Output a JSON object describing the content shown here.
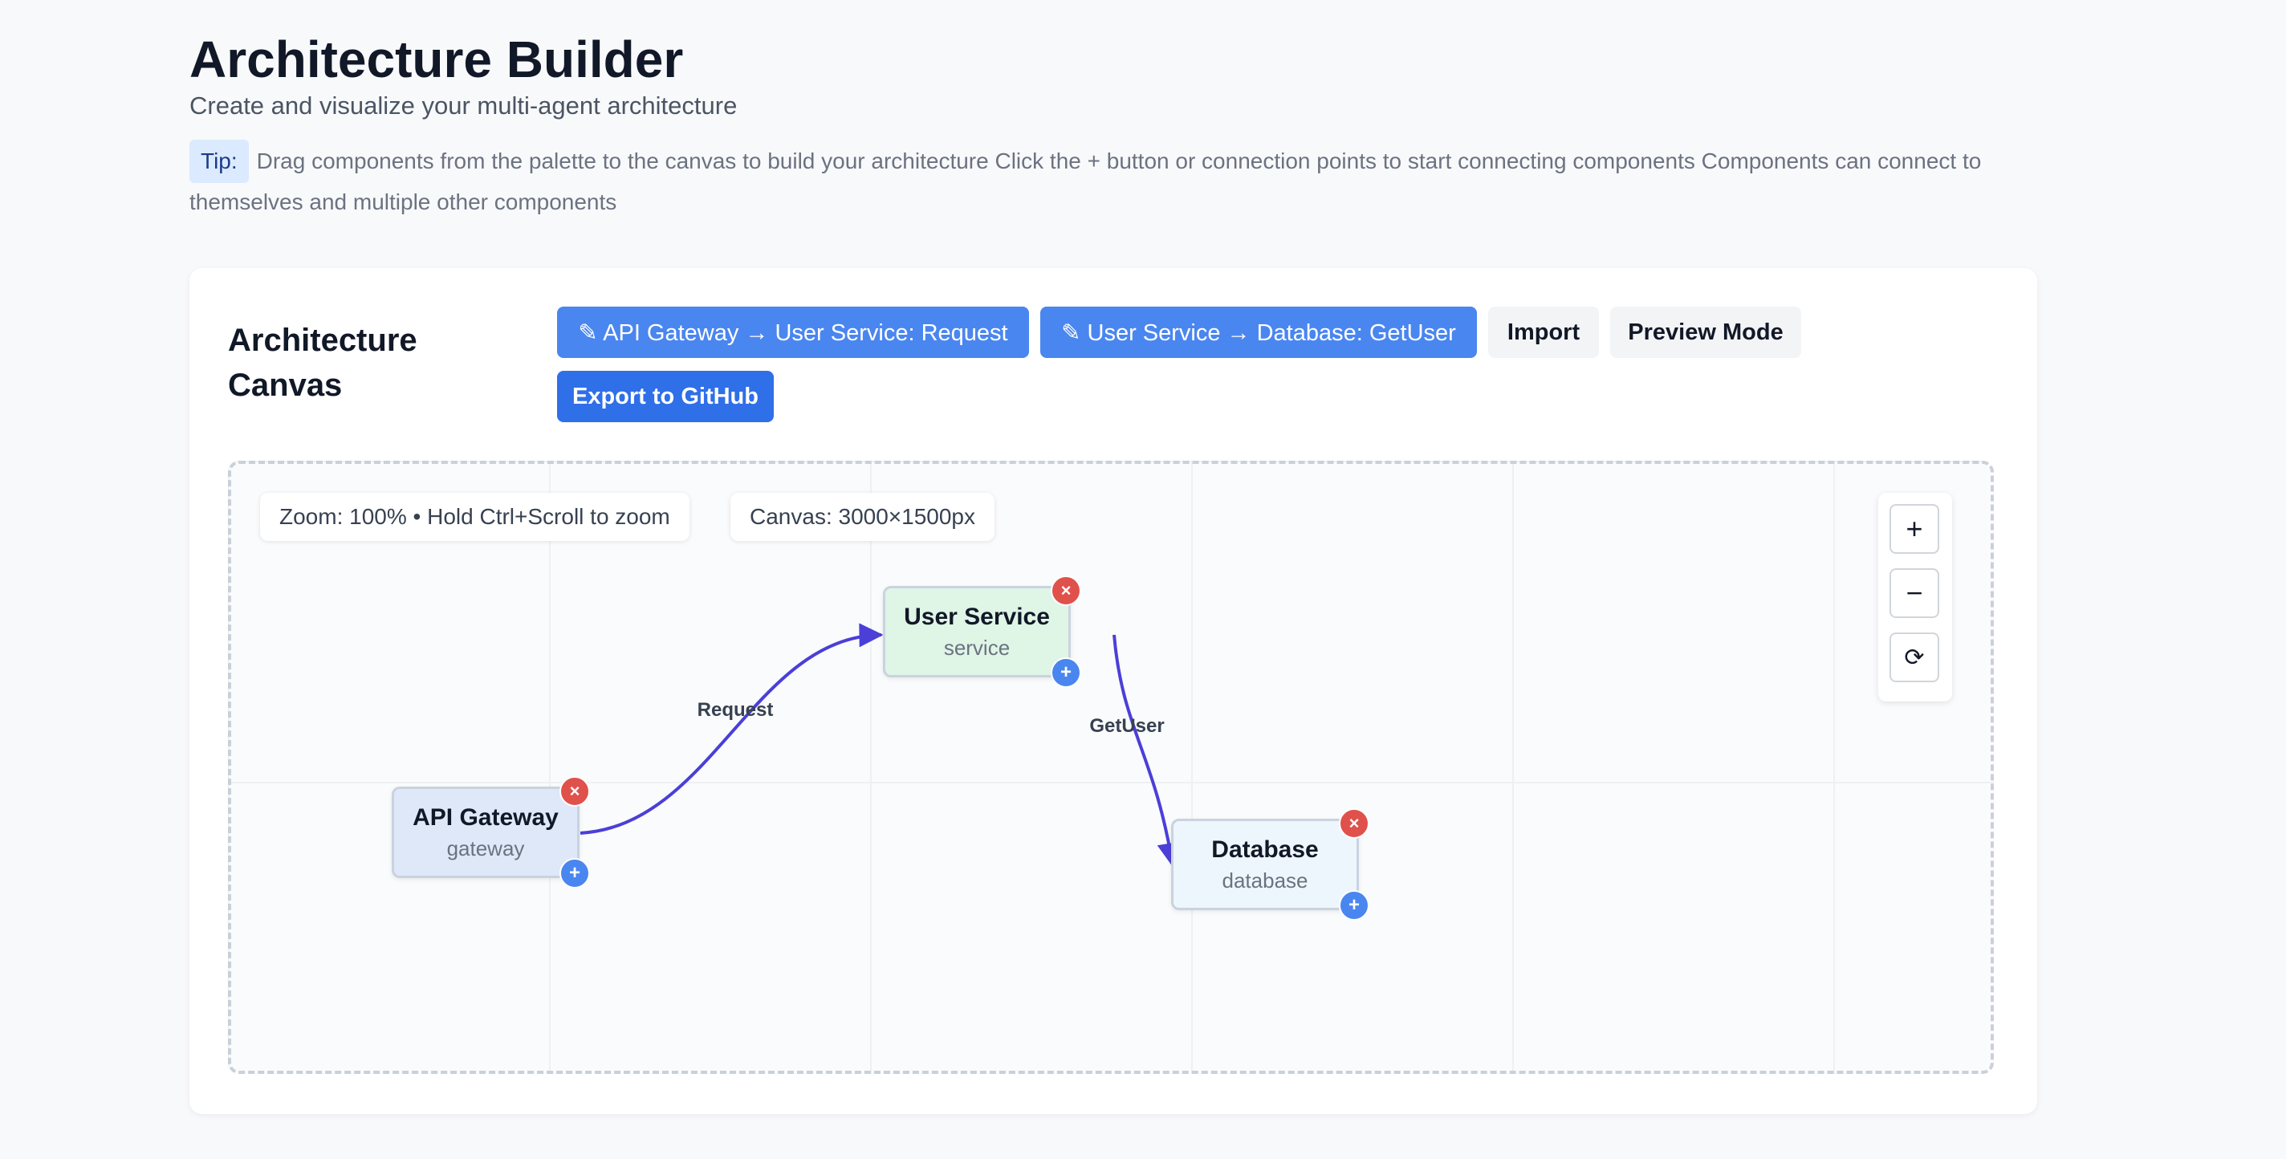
{
  "header": {
    "title": "Architecture Builder",
    "subtitle": "Create and visualize your multi-agent architecture",
    "tip_label": "Tip:",
    "tip_text": "Drag components from the palette to the canvas to build your architecture  Click the + button or connection points to start connecting components  Components can connect to themselves and multiple other components"
  },
  "canvas_card": {
    "title": "Architecture Canvas",
    "toolbar": {
      "connection_buttons": [
        "✎ API Gateway → User Service: Request",
        "✎ User Service → Database: GetUser"
      ],
      "import_label": "Import",
      "preview_label": "Preview Mode",
      "export_label": "Export to GitHub"
    },
    "canvas": {
      "zoom_info": "Zoom: 100% • Hold Ctrl+Scroll to zoom",
      "size_info": "Canvas: 3000×1500px",
      "zoom_controls": {
        "zoom_in": "+",
        "zoom_out": "−",
        "reset": "⟳"
      },
      "nodes": [
        {
          "name": "API Gateway",
          "type": "gateway",
          "color": "#dfe8f8"
        },
        {
          "name": "User Service",
          "type": "service",
          "color": "#dff5e6"
        },
        {
          "name": "Database",
          "type": "database",
          "color": "#eef6fd"
        }
      ],
      "node_delete_symbol": "×",
      "node_add_symbol": "+",
      "edges": [
        {
          "from": "API Gateway",
          "to": "User Service",
          "label": "Request"
        },
        {
          "from": "User Service",
          "to": "Database",
          "label": "GetUser"
        }
      ],
      "edge_color": "#4b3fd8"
    }
  }
}
